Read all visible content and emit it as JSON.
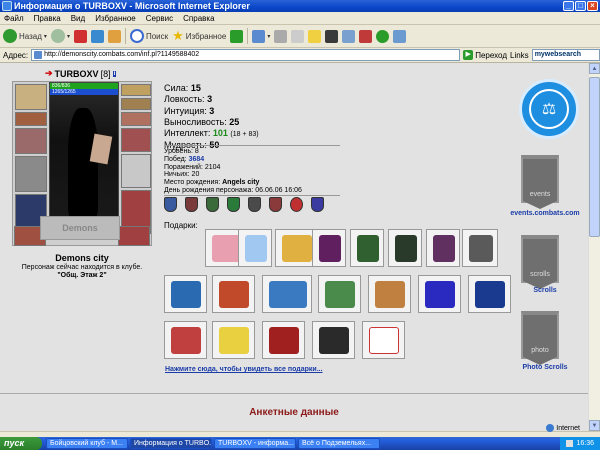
{
  "window": {
    "title": "Информация о TURBOXV - Microsoft Internet Explorer"
  },
  "menu": [
    "Файл",
    "Правка",
    "Вид",
    "Избранное",
    "Сервис",
    "Справка"
  ],
  "toolbar": {
    "back_label": "Назад",
    "search_label": "Поиск",
    "favorites_label": "Избранное"
  },
  "address": {
    "label": "Адрес:",
    "url": "http://demonscity.combats.com/inf.pl?1149588402",
    "go_label": "Переход",
    "links_label": "Links",
    "search_box": "mywebsearch"
  },
  "character": {
    "name": "TURBOXV",
    "level": "[8]",
    "info_icon": "i",
    "hp": "836/836",
    "mp": "1265/1265",
    "city_banner": "Demons",
    "city": "Demons city",
    "location_note": "Персонаж сейчас находится в клубе.",
    "location_room": "\"Общ. Этаж 2\""
  },
  "stats": [
    {
      "label": "Сила:",
      "value": "15"
    },
    {
      "label": "Ловкость:",
      "value": "3"
    },
    {
      "label": "Интуиция:",
      "value": "3"
    },
    {
      "label": "Выносливость:",
      "value": "25"
    },
    {
      "label": "Интеллект:",
      "value": "101",
      "extra": "(18 + 83)"
    },
    {
      "label": "Мудрость:",
      "value": "50"
    }
  ],
  "info": {
    "level": "Уровень: 8",
    "wins_label": "Побед:",
    "wins": "3684",
    "losses": "Поражений: 2104",
    "draws": "Ничьих: 20",
    "birthplace_label": "Место рождения:",
    "birthplace": "Angels city",
    "birthday": "День рождения персонажа: 06.06.06 16:06"
  },
  "gifts": {
    "title": "Подарки:",
    "link": "Нажмите сюда, чтобы увидеть все подарки..."
  },
  "section_title": "Анкетные данные",
  "right": {
    "events_link": "events.combats.com",
    "scrolls_link": "Scrolls",
    "photo_link": "Photo Scrolls",
    "events_banner": "events",
    "scrolls_banner": "scrolls",
    "photo_banner": "photo"
  },
  "status": {
    "zone": "Internet"
  },
  "taskbar": {
    "start": "пуск",
    "tasks": [
      "Бойцовский клуб - M...",
      "Информация о TURBO...",
      "TURBOXV - информа...",
      "Всё о Подземельях..."
    ],
    "clock": "16:36"
  },
  "colors": {
    "title_blue": "#0a46c8",
    "link_blue": "#1a3ca8",
    "section_red": "#8c1a1a",
    "int_green": "#1a8a1a"
  }
}
